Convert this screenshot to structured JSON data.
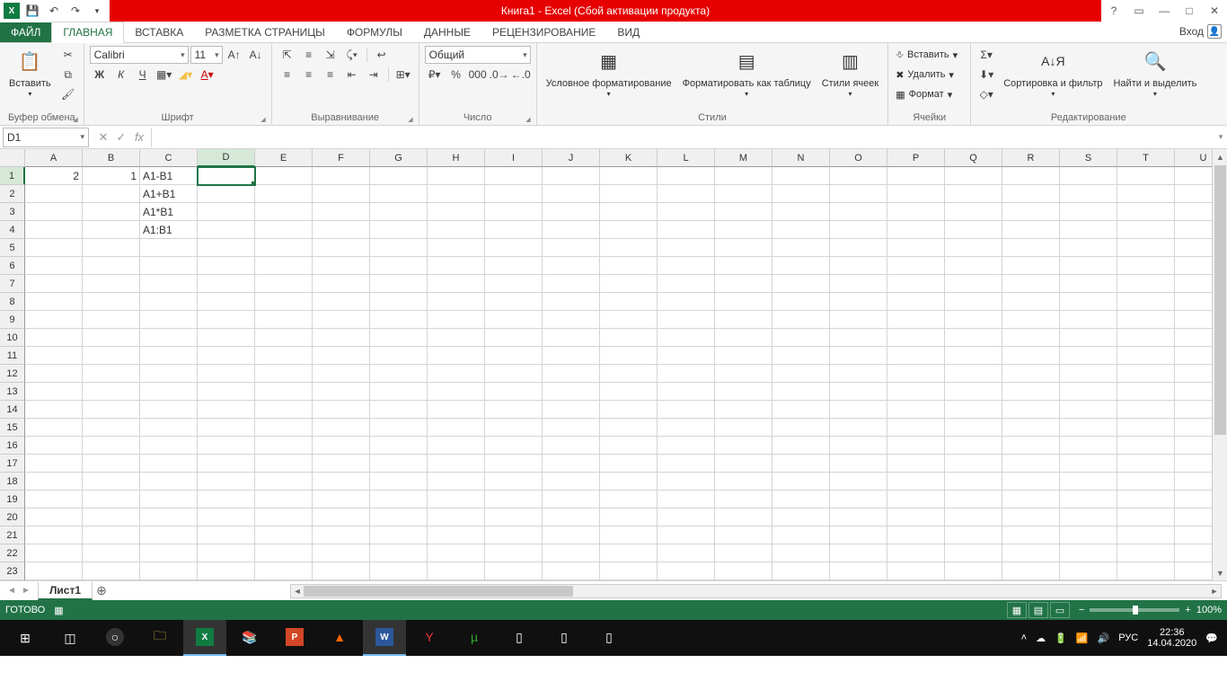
{
  "title": "Книга1 -  Excel (Сбой активации продукта)",
  "qat": {
    "save": "💾",
    "undo": "↶",
    "redo": "↷"
  },
  "tabs": {
    "file": "ФАЙЛ",
    "items": [
      "ГЛАВНАЯ",
      "ВСТАВКА",
      "РАЗМЕТКА СТРАНИЦЫ",
      "ФОРМУЛЫ",
      "ДАННЫЕ",
      "РЕЦЕНЗИРОВАНИЕ",
      "ВИД"
    ],
    "active": "ГЛАВНАЯ",
    "signin": "Вход"
  },
  "ribbon": {
    "clipboard": {
      "paste": "Вставить",
      "label": "Буфер обмена"
    },
    "font": {
      "name": "Calibri",
      "size": "11",
      "bold": "Ж",
      "italic": "К",
      "underline": "Ч",
      "label": "Шрифт"
    },
    "align": {
      "label": "Выравнивание"
    },
    "number": {
      "format": "Общий",
      "label": "Число"
    },
    "styles": {
      "cond": "Условное форматирование",
      "table": "Форматировать как таблицу",
      "cell": "Стили ячеек",
      "label": "Стили"
    },
    "cells": {
      "insert": "Вставить",
      "delete": "Удалить",
      "format": "Формат",
      "label": "Ячейки"
    },
    "editing": {
      "sort": "Сортировка и фильтр",
      "find": "Найти и выделить",
      "label": "Редактирование"
    }
  },
  "namebox": "D1",
  "formula": "",
  "columns": [
    "A",
    "B",
    "C",
    "D",
    "E",
    "F",
    "G",
    "H",
    "I",
    "J",
    "K",
    "L",
    "M",
    "N",
    "O",
    "P",
    "Q",
    "R",
    "S",
    "T",
    "U"
  ],
  "row_count": 23,
  "active_cell": {
    "col": "D",
    "row": 1
  },
  "data": {
    "A1": "2",
    "B1": "1",
    "C1": "A1-B1",
    "C2": "A1+B1",
    "C3": "A1*B1",
    "C4": "A1:B1"
  },
  "sheet_tab": "Лист1",
  "status": "ГОТОВО",
  "zoom": "100%",
  "tray": {
    "lang": "РУС",
    "time": "22:36",
    "date": "14.04.2020"
  }
}
